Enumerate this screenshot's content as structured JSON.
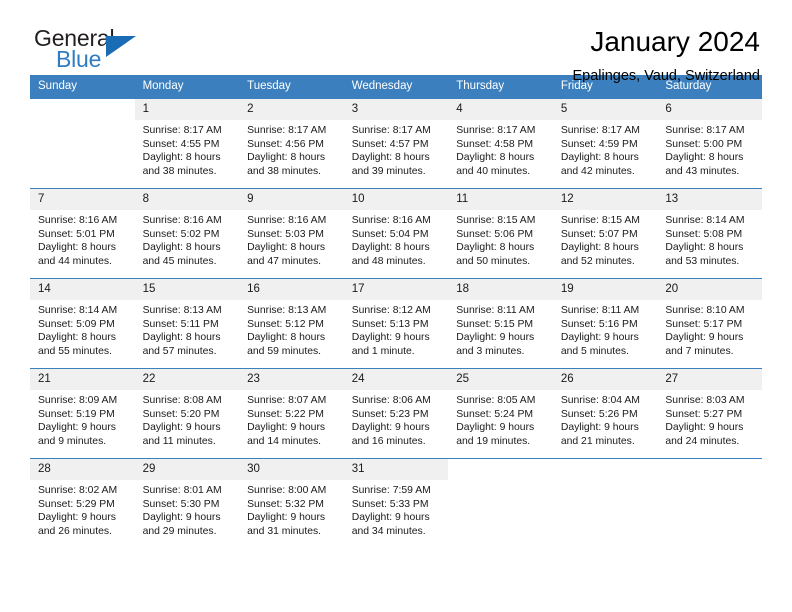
{
  "brand": {
    "name_top": "General",
    "name_bottom": "Blue",
    "color_dark": "#231f20",
    "color_blue": "#2f7cc0",
    "triangle_color": "#1a6cb5"
  },
  "header": {
    "title": "January 2024",
    "subtitle": "Epalinges, Vaud, Switzerland"
  },
  "theme": {
    "header_row_bg": "#3c7fbe",
    "daynum_bg": "#f0f0f0",
    "row_border": "#3c7fbe"
  },
  "weekdays": [
    "Sunday",
    "Monday",
    "Tuesday",
    "Wednesday",
    "Thursday",
    "Friday",
    "Saturday"
  ],
  "weeks": [
    [
      {
        "day": "",
        "sunrise": "",
        "sunset": "",
        "daylight_line1": "",
        "daylight_line2": ""
      },
      {
        "day": "1",
        "sunrise": "Sunrise: 8:17 AM",
        "sunset": "Sunset: 4:55 PM",
        "daylight_line1": "Daylight: 8 hours",
        "daylight_line2": "and 38 minutes."
      },
      {
        "day": "2",
        "sunrise": "Sunrise: 8:17 AM",
        "sunset": "Sunset: 4:56 PM",
        "daylight_line1": "Daylight: 8 hours",
        "daylight_line2": "and 38 minutes."
      },
      {
        "day": "3",
        "sunrise": "Sunrise: 8:17 AM",
        "sunset": "Sunset: 4:57 PM",
        "daylight_line1": "Daylight: 8 hours",
        "daylight_line2": "and 39 minutes."
      },
      {
        "day": "4",
        "sunrise": "Sunrise: 8:17 AM",
        "sunset": "Sunset: 4:58 PM",
        "daylight_line1": "Daylight: 8 hours",
        "daylight_line2": "and 40 minutes."
      },
      {
        "day": "5",
        "sunrise": "Sunrise: 8:17 AM",
        "sunset": "Sunset: 4:59 PM",
        "daylight_line1": "Daylight: 8 hours",
        "daylight_line2": "and 42 minutes."
      },
      {
        "day": "6",
        "sunrise": "Sunrise: 8:17 AM",
        "sunset": "Sunset: 5:00 PM",
        "daylight_line1": "Daylight: 8 hours",
        "daylight_line2": "and 43 minutes."
      }
    ],
    [
      {
        "day": "7",
        "sunrise": "Sunrise: 8:16 AM",
        "sunset": "Sunset: 5:01 PM",
        "daylight_line1": "Daylight: 8 hours",
        "daylight_line2": "and 44 minutes."
      },
      {
        "day": "8",
        "sunrise": "Sunrise: 8:16 AM",
        "sunset": "Sunset: 5:02 PM",
        "daylight_line1": "Daylight: 8 hours",
        "daylight_line2": "and 45 minutes."
      },
      {
        "day": "9",
        "sunrise": "Sunrise: 8:16 AM",
        "sunset": "Sunset: 5:03 PM",
        "daylight_line1": "Daylight: 8 hours",
        "daylight_line2": "and 47 minutes."
      },
      {
        "day": "10",
        "sunrise": "Sunrise: 8:16 AM",
        "sunset": "Sunset: 5:04 PM",
        "daylight_line1": "Daylight: 8 hours",
        "daylight_line2": "and 48 minutes."
      },
      {
        "day": "11",
        "sunrise": "Sunrise: 8:15 AM",
        "sunset": "Sunset: 5:06 PM",
        "daylight_line1": "Daylight: 8 hours",
        "daylight_line2": "and 50 minutes."
      },
      {
        "day": "12",
        "sunrise": "Sunrise: 8:15 AM",
        "sunset": "Sunset: 5:07 PM",
        "daylight_line1": "Daylight: 8 hours",
        "daylight_line2": "and 52 minutes."
      },
      {
        "day": "13",
        "sunrise": "Sunrise: 8:14 AM",
        "sunset": "Sunset: 5:08 PM",
        "daylight_line1": "Daylight: 8 hours",
        "daylight_line2": "and 53 minutes."
      }
    ],
    [
      {
        "day": "14",
        "sunrise": "Sunrise: 8:14 AM",
        "sunset": "Sunset: 5:09 PM",
        "daylight_line1": "Daylight: 8 hours",
        "daylight_line2": "and 55 minutes."
      },
      {
        "day": "15",
        "sunrise": "Sunrise: 8:13 AM",
        "sunset": "Sunset: 5:11 PM",
        "daylight_line1": "Daylight: 8 hours",
        "daylight_line2": "and 57 minutes."
      },
      {
        "day": "16",
        "sunrise": "Sunrise: 8:13 AM",
        "sunset": "Sunset: 5:12 PM",
        "daylight_line1": "Daylight: 8 hours",
        "daylight_line2": "and 59 minutes."
      },
      {
        "day": "17",
        "sunrise": "Sunrise: 8:12 AM",
        "sunset": "Sunset: 5:13 PM",
        "daylight_line1": "Daylight: 9 hours",
        "daylight_line2": "and 1 minute."
      },
      {
        "day": "18",
        "sunrise": "Sunrise: 8:11 AM",
        "sunset": "Sunset: 5:15 PM",
        "daylight_line1": "Daylight: 9 hours",
        "daylight_line2": "and 3 minutes."
      },
      {
        "day": "19",
        "sunrise": "Sunrise: 8:11 AM",
        "sunset": "Sunset: 5:16 PM",
        "daylight_line1": "Daylight: 9 hours",
        "daylight_line2": "and 5 minutes."
      },
      {
        "day": "20",
        "sunrise": "Sunrise: 8:10 AM",
        "sunset": "Sunset: 5:17 PM",
        "daylight_line1": "Daylight: 9 hours",
        "daylight_line2": "and 7 minutes."
      }
    ],
    [
      {
        "day": "21",
        "sunrise": "Sunrise: 8:09 AM",
        "sunset": "Sunset: 5:19 PM",
        "daylight_line1": "Daylight: 9 hours",
        "daylight_line2": "and 9 minutes."
      },
      {
        "day": "22",
        "sunrise": "Sunrise: 8:08 AM",
        "sunset": "Sunset: 5:20 PM",
        "daylight_line1": "Daylight: 9 hours",
        "daylight_line2": "and 11 minutes."
      },
      {
        "day": "23",
        "sunrise": "Sunrise: 8:07 AM",
        "sunset": "Sunset: 5:22 PM",
        "daylight_line1": "Daylight: 9 hours",
        "daylight_line2": "and 14 minutes."
      },
      {
        "day": "24",
        "sunrise": "Sunrise: 8:06 AM",
        "sunset": "Sunset: 5:23 PM",
        "daylight_line1": "Daylight: 9 hours",
        "daylight_line2": "and 16 minutes."
      },
      {
        "day": "25",
        "sunrise": "Sunrise: 8:05 AM",
        "sunset": "Sunset: 5:24 PM",
        "daylight_line1": "Daylight: 9 hours",
        "daylight_line2": "and 19 minutes."
      },
      {
        "day": "26",
        "sunrise": "Sunrise: 8:04 AM",
        "sunset": "Sunset: 5:26 PM",
        "daylight_line1": "Daylight: 9 hours",
        "daylight_line2": "and 21 minutes."
      },
      {
        "day": "27",
        "sunrise": "Sunrise: 8:03 AM",
        "sunset": "Sunset: 5:27 PM",
        "daylight_line1": "Daylight: 9 hours",
        "daylight_line2": "and 24 minutes."
      }
    ],
    [
      {
        "day": "28",
        "sunrise": "Sunrise: 8:02 AM",
        "sunset": "Sunset: 5:29 PM",
        "daylight_line1": "Daylight: 9 hours",
        "daylight_line2": "and 26 minutes."
      },
      {
        "day": "29",
        "sunrise": "Sunrise: 8:01 AM",
        "sunset": "Sunset: 5:30 PM",
        "daylight_line1": "Daylight: 9 hours",
        "daylight_line2": "and 29 minutes."
      },
      {
        "day": "30",
        "sunrise": "Sunrise: 8:00 AM",
        "sunset": "Sunset: 5:32 PM",
        "daylight_line1": "Daylight: 9 hours",
        "daylight_line2": "and 31 minutes."
      },
      {
        "day": "31",
        "sunrise": "Sunrise: 7:59 AM",
        "sunset": "Sunset: 5:33 PM",
        "daylight_line1": "Daylight: 9 hours",
        "daylight_line2": "and 34 minutes."
      },
      {
        "day": "",
        "sunrise": "",
        "sunset": "",
        "daylight_line1": "",
        "daylight_line2": ""
      },
      {
        "day": "",
        "sunrise": "",
        "sunset": "",
        "daylight_line1": "",
        "daylight_line2": ""
      },
      {
        "day": "",
        "sunrise": "",
        "sunset": "",
        "daylight_line1": "",
        "daylight_line2": ""
      }
    ]
  ]
}
